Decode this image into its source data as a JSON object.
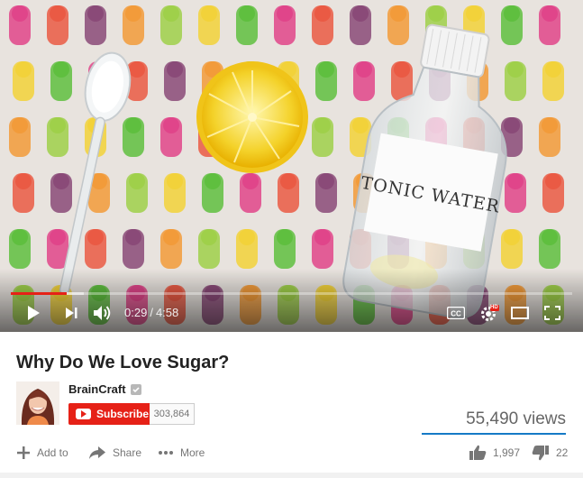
{
  "player": {
    "label_text": "TONIC WATER",
    "time_current": "0:29",
    "time_separator": "/",
    "time_total": "4:58",
    "progress_fraction": 0.1,
    "buffer_fraction": 0.13,
    "settings_badge": "HD"
  },
  "video": {
    "title": "Why Do We Love Sugar?",
    "channel": "BrainCraft",
    "subscribe_label": "Subscribe",
    "subscriber_count": "303,864",
    "views": "55,490 views",
    "likes": "1,997",
    "dislikes": "22",
    "like_fraction": 0.989
  },
  "actions": {
    "add_to": "Add to",
    "share": "Share",
    "more": "More"
  },
  "colors": {
    "accent": "#e62117",
    "like_bar": "#167ac6"
  }
}
